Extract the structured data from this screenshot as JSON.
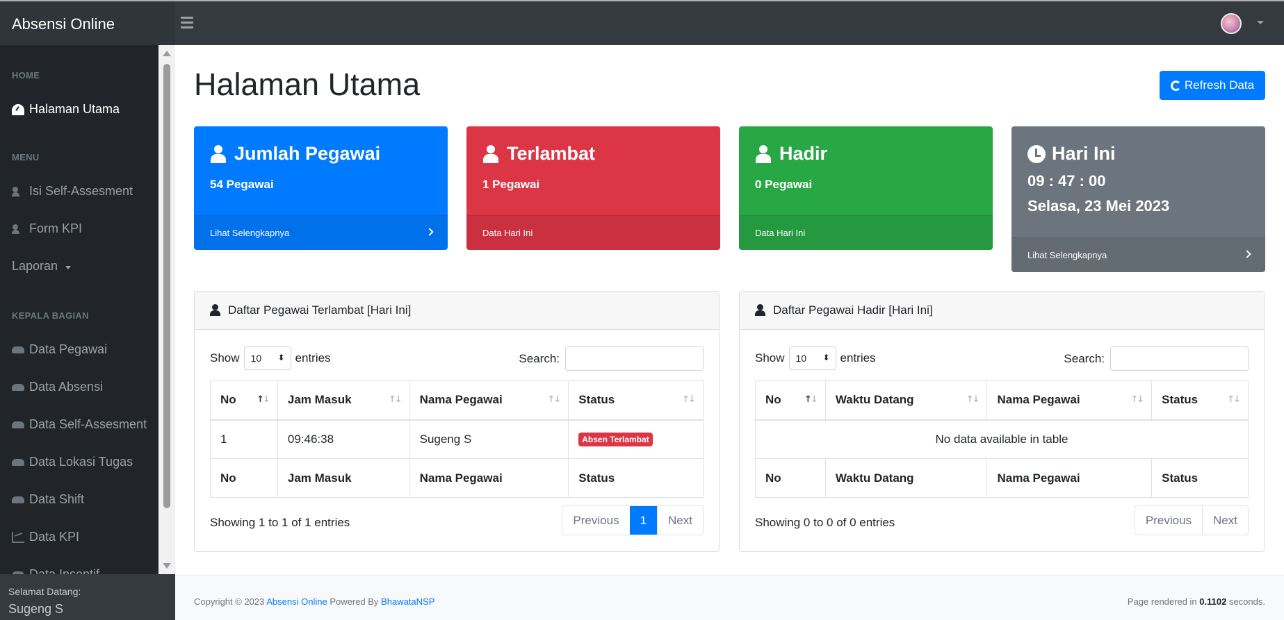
{
  "app": {
    "brand": "Absensi Online"
  },
  "sidebar": {
    "headings": {
      "home": "HOME",
      "menu": "MENU",
      "kepala": "KEPALA BAGIAN"
    },
    "items": [
      {
        "label": "Halaman Utama",
        "icon": "gauge-icon"
      },
      {
        "label": "Isi Self-Assesment",
        "icon": "user-check-icon"
      },
      {
        "label": "Form KPI",
        "icon": "user-check-icon"
      },
      {
        "label": "Laporan",
        "icon": ""
      },
      {
        "label": "Data Pegawai",
        "icon": "users-icon"
      },
      {
        "label": "Data Absensi",
        "icon": "users-icon"
      },
      {
        "label": "Data Self-Assesment",
        "icon": "users-icon"
      },
      {
        "label": "Data Lokasi Tugas",
        "icon": "users-icon"
      },
      {
        "label": "Data Shift",
        "icon": "users-icon"
      },
      {
        "label": "Data KPI",
        "icon": "chart-icon"
      },
      {
        "label": "Data Insentif",
        "icon": "users-icon"
      }
    ],
    "footer": {
      "label": "Selamat Datang:",
      "name": "Sugeng S"
    }
  },
  "main": {
    "title": "Halaman Utama",
    "refresh_label": "Refresh Data",
    "cards": [
      {
        "title": "Jumlah Pegawai",
        "value": "54 Pegawai",
        "footer": "Lihat Selengkapnya",
        "color": "#007bff"
      },
      {
        "title": "Terlambat",
        "value": "1 Pegawai",
        "footer": "Data Hari Ini",
        "color": "#dc3545"
      },
      {
        "title": "Hadir",
        "value": "0 Pegawai",
        "footer": "Data Hari Ini",
        "color": "#28a745"
      },
      {
        "title": "Hari Ini",
        "time": "09 : 47 : 00",
        "date": "Selasa, 23 Mei 2023",
        "footer": "Lihat Selengkapnya",
        "color": "#6c757d"
      }
    ],
    "late_panel": {
      "title": "Daftar Pegawai Terlambat [Hari Ini]",
      "show": "Show",
      "length": "10",
      "entries": "entries",
      "search": "Search:",
      "columns": [
        "No",
        "Jam Masuk",
        "Nama Pegawai",
        "Status"
      ],
      "rows": [
        {
          "no": "1",
          "time": "09:46:38",
          "name": "Sugeng S",
          "status": "Absen Terlambat"
        }
      ],
      "info": "Showing 1 to 1 of 1 entries",
      "pager": {
        "prev": "Previous",
        "page": "1",
        "next": "Next"
      }
    },
    "present_panel": {
      "title": "Daftar Pegawai Hadir [Hari Ini]",
      "show": "Show",
      "length": "10",
      "entries": "entries",
      "search": "Search:",
      "columns": [
        "No",
        "Waktu Datang",
        "Nama Pegawai",
        "Status"
      ],
      "empty": "No data available in table",
      "info": "Showing 0 to 0 of 0 entries",
      "pager": {
        "prev": "Previous",
        "next": "Next"
      }
    }
  },
  "footer": {
    "copyright": "Copyright © 2023",
    "app_link": "Absensi Online",
    "powered": "Powered By",
    "author_link": "BhawataNSP",
    "rendered_pre": "Page rendered in",
    "rendered_val": "0.1102",
    "rendered_post": "seconds."
  }
}
